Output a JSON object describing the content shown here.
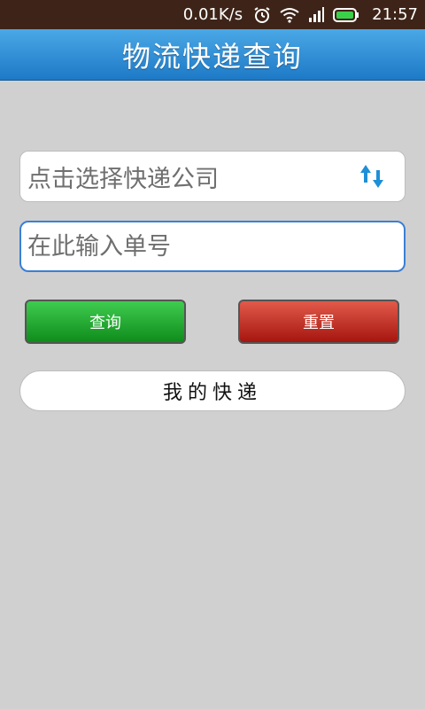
{
  "status_bar": {
    "speed": "0.01K/s",
    "time": "21:57",
    "icons": [
      "alarm-icon",
      "wifi-icon",
      "signal-icon",
      "battery-icon"
    ],
    "battery_color": "#3ad14a"
  },
  "header": {
    "title": "物流快递查询",
    "color": "#2a8bd8"
  },
  "form": {
    "company_placeholder": "点击选择快递公司",
    "tracking_placeholder": "在此输入单号",
    "query_label": "查询",
    "reset_label": "重置",
    "my_packages_label": "我的快递"
  },
  "colors": {
    "query_button": "#1e9f2b",
    "reset_button": "#c62a1f",
    "swap_icon": "#1e8fd8"
  }
}
